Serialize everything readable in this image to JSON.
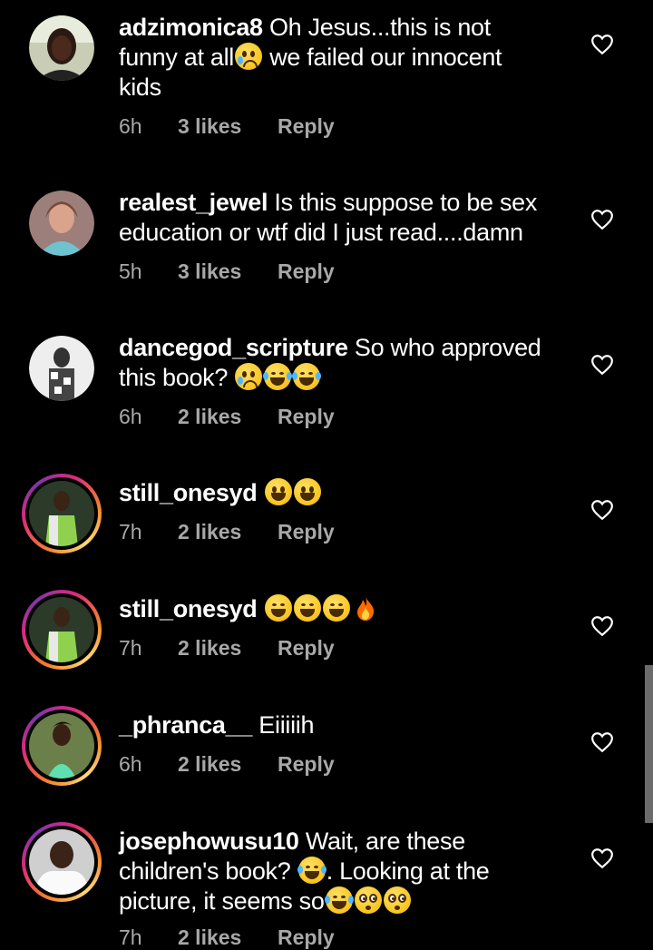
{
  "comments": [
    {
      "username": "adzimonica8",
      "parts": [
        "Oh Jesus...this is not",
        "funny at all",
        "we failed our innocent",
        "kids"
      ],
      "time": "6h",
      "likes": "3 likes",
      "reply": "Reply"
    },
    {
      "username": "realest_jewel",
      "parts": [
        "Is this suppose to be sex",
        "education or wtf did I just read....damn"
      ],
      "time": "5h",
      "likes": "3 likes",
      "reply": "Reply"
    },
    {
      "username": "dancegod_scripture",
      "parts": [
        "So who approved",
        "this book?"
      ],
      "time": "6h",
      "likes": "2 likes",
      "reply": "Reply"
    },
    {
      "username": "still_onesyd",
      "parts": [],
      "time": "7h",
      "likes": "2 likes",
      "reply": "Reply"
    },
    {
      "username": "still_onesyd",
      "parts": [],
      "time": "7h",
      "likes": "2 likes",
      "reply": "Reply"
    },
    {
      "username": "_phranca__",
      "parts": [
        "Eiiiiih"
      ],
      "time": "6h",
      "likes": "2 likes",
      "reply": "Reply"
    },
    {
      "username": "josephowusu10",
      "parts": [
        "Wait, are these",
        "children's book?",
        ". Looking at the",
        "picture, it seems so"
      ],
      "time": "7h",
      "likes": "2 likes",
      "reply": "Reply"
    }
  ],
  "icons": {
    "like": "heart-outline-icon",
    "emoji_crying": "crying-face-emoji",
    "emoji_laugh_tears": "face-with-tears-of-joy-emoji",
    "emoji_grin": "grinning-face-emoji",
    "emoji_fire": "fire-emoji",
    "emoji_flushed": "flushed-face-emoji"
  },
  "colors": {
    "background": "#000000",
    "text": "#ffffff",
    "meta": "#a8a8a8",
    "story_ring": "#dd2a7b"
  }
}
